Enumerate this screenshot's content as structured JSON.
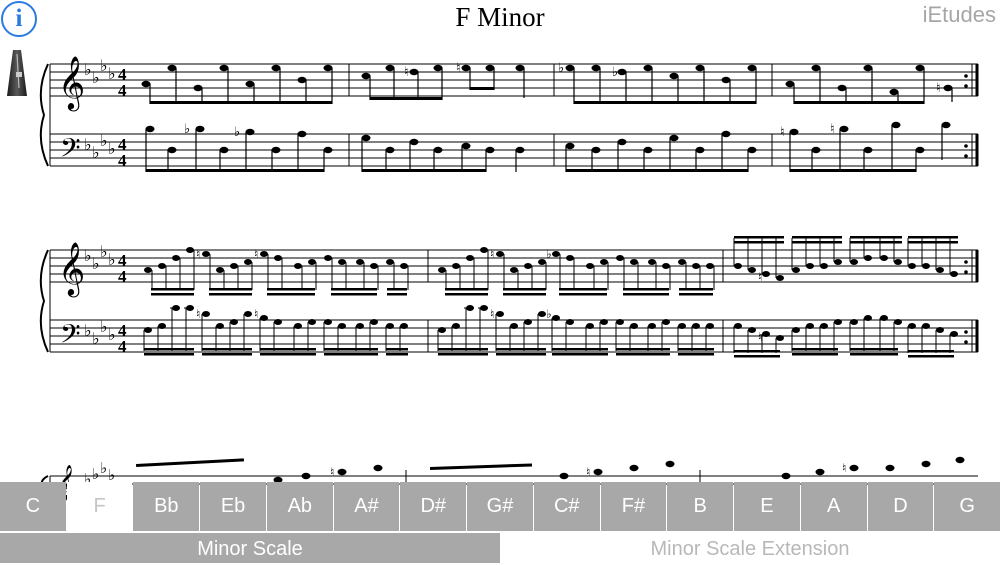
{
  "header": {
    "title": "F Minor",
    "brand": "iEtudes",
    "info_glyph": "i",
    "info_icon": "info-icon",
    "metronome_icon": "metronome-icon",
    "accent_color": "#2a7be0"
  },
  "score": {
    "key_signature": "4 flats",
    "time_signature": "4/4",
    "systems_visible": 3
  },
  "key_selector": {
    "keys": [
      "C",
      "F",
      "Bb",
      "Eb",
      "Ab",
      "A#",
      "D#",
      "G#",
      "C#",
      "F#",
      "B",
      "E",
      "A",
      "D",
      "G"
    ],
    "selected": "F",
    "key_bg": "#a8a8a8",
    "key_fg": "#ffffff"
  },
  "tabs": {
    "items": [
      "Minor Scale",
      "Minor Scale Extension"
    ],
    "active": "Minor Scale"
  }
}
